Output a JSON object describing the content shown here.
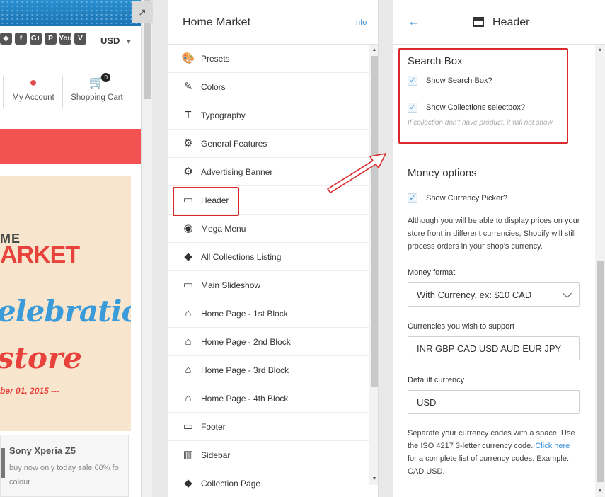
{
  "preview": {
    "social_icons": [
      "pinterest-like-icon",
      "facebook-icon",
      "google-plus-icon",
      "pinterest-icon",
      "youtube-icon",
      "vimeo-icon"
    ],
    "social_glyphs": [
      "◈",
      "f",
      "G+",
      "P",
      "You",
      "V"
    ],
    "currency": "USD",
    "my_account": "My Account",
    "shopping_cart": "Shopping Cart",
    "cart_count": "0",
    "banner_me": "ME",
    "banner_market": "ARKET",
    "banner_celebration": "elebration",
    "banner_store": "store",
    "banner_date": "ber 01, 2015 ---",
    "product_name": "Sony Xperia Z5",
    "product_desc": "buy now only today sale 60% fo colour"
  },
  "menu": {
    "title": "Home Market",
    "info": "Info",
    "items": [
      {
        "label": "Presets",
        "icon": "🎨"
      },
      {
        "label": "Colors",
        "icon": "✎"
      },
      {
        "label": "Typography",
        "icon": "T"
      },
      {
        "label": "General Features",
        "icon": "⚙"
      },
      {
        "label": "Advertising Banner",
        "icon": "⚙"
      },
      {
        "label": "Header",
        "icon": "▭"
      },
      {
        "label": "Mega Menu",
        "icon": "◉"
      },
      {
        "label": "All Collections Listing",
        "icon": "◆"
      },
      {
        "label": "Main Slideshow",
        "icon": "▭"
      },
      {
        "label": "Home Page - 1st Block",
        "icon": "⌂"
      },
      {
        "label": "Home Page - 2nd Block",
        "icon": "⌂"
      },
      {
        "label": "Home Page - 3rd Block",
        "icon": "⌂"
      },
      {
        "label": "Home Page - 4th Block",
        "icon": "⌂"
      },
      {
        "label": "Footer",
        "icon": "▭"
      },
      {
        "label": "Sidebar",
        "icon": "▥"
      },
      {
        "label": "Collection Page",
        "icon": "◆"
      }
    ]
  },
  "panel": {
    "back": "←",
    "title": "Header",
    "search_box": {
      "title": "Search Box",
      "show_search": "Show Search Box?",
      "show_collections": "Show Collections selectbox?",
      "hint": "If collection don't have product, it will not show"
    },
    "money": {
      "title": "Money options",
      "show_currency": "Show Currency Picker?",
      "description": "Although you will be able to display prices on your store front in different currencies, Shopify will still process orders in your shop's currency.",
      "format_label": "Money format",
      "format_value": "With Currency, ex: $10 CAD",
      "currencies_label": "Currencies you wish to support",
      "currencies_value": "INR GBP CAD USD AUD EUR JPY",
      "default_label": "Default currency",
      "default_value": "USD",
      "note_before": "Separate your currency codes with a space. Use the ISO 4217 3-letter currency code.",
      "note_link": "Click here",
      "note_after": "for a complete list of currency codes. Example: CAD USD."
    }
  },
  "colors": {
    "accent": "#3a8fd6",
    "highlight": "#d9282a",
    "store_red": "#f25252"
  }
}
